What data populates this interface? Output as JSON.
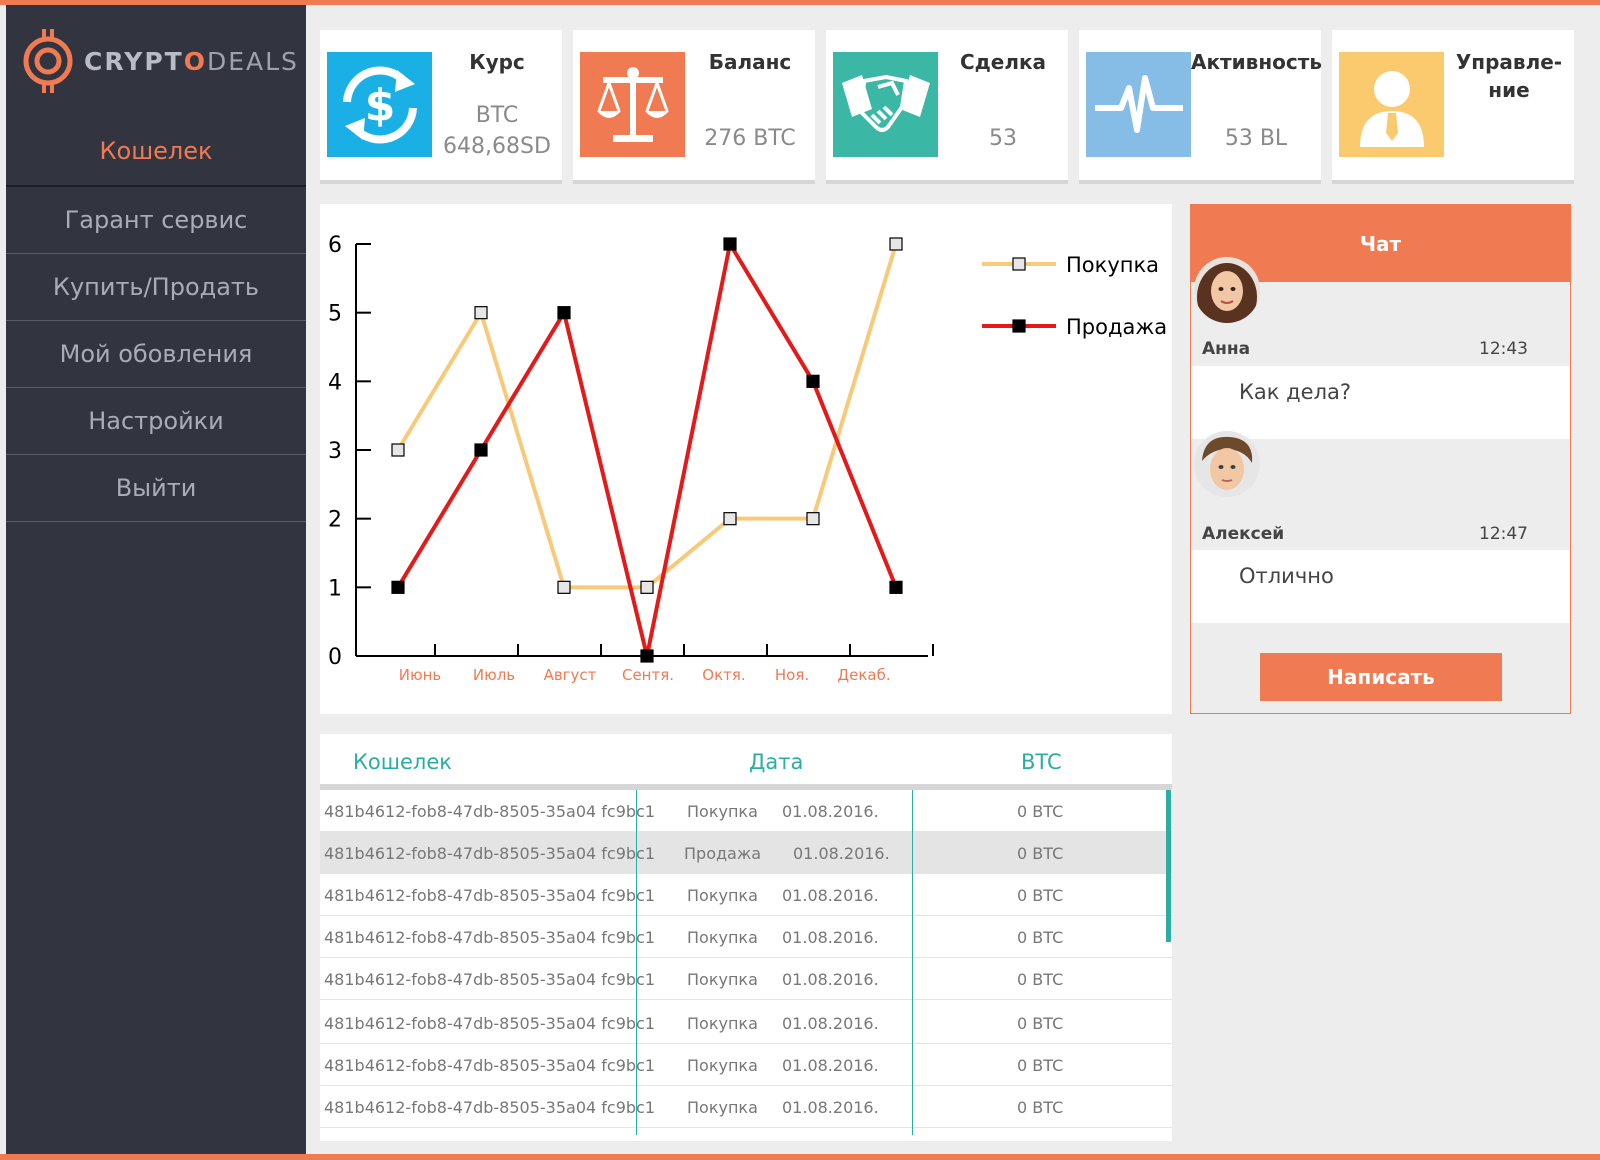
{
  "brand": {
    "crypto": "CRYPT",
    "o": "O",
    "deals": "DEALS"
  },
  "nav": {
    "items": [
      "Кошелек",
      "Гарант сервис",
      "Купить/Продать",
      "Мой обовления",
      "Настройки",
      "Выйти"
    ],
    "active": "Кошелек"
  },
  "cards": [
    {
      "title": "Курс",
      "line1": "BTC",
      "line2": "648,68SD",
      "icon": "dollar-exchange-icon",
      "color": "#1ab0e6"
    },
    {
      "title": "Баланс",
      "value": "276 BTC",
      "icon": "scales-icon",
      "color": "#f07a52"
    },
    {
      "title": "Сделка",
      "value": "53",
      "icon": "handshake-icon",
      "color": "#3bb7a6"
    },
    {
      "title": "Активность",
      "value": "53 BL",
      "icon": "pulse-icon",
      "color": "#86bde6"
    },
    {
      "title": "Управле-",
      "title2": "ние",
      "icon": "manager-icon",
      "color": "#fbc96e"
    }
  ],
  "chart_data": {
    "type": "line",
    "categories": [
      "Июнь",
      "Июль",
      "Август",
      "Сентя.",
      "Октя.",
      "Ноя.",
      "Декаб."
    ],
    "x": [
      0,
      1,
      2,
      3,
      4,
      5,
      6
    ],
    "series": [
      {
        "name": "Покупка",
        "color": "#f9c97a",
        "marker": "square-open",
        "values": [
          3,
          5,
          1,
          1,
          2,
          2,
          6
        ]
      },
      {
        "name": "Продажа",
        "color": "#e41a1a",
        "marker": "square-filled",
        "values": [
          1,
          3,
          5,
          0,
          6,
          4,
          1
        ]
      }
    ],
    "yticks": [
      0,
      1,
      2,
      3,
      4,
      5,
      6
    ],
    "ylim": [
      0,
      6
    ],
    "legend": "top-right",
    "grid": false
  },
  "chat": {
    "title": "Чат",
    "messages": [
      {
        "name": "Анна",
        "time": "12:43",
        "text": "Как дела?"
      },
      {
        "name": "Алексей",
        "time": "12:47",
        "text": "Отлично"
      }
    ],
    "button": "Написать"
  },
  "table": {
    "headers": [
      "Кошелек",
      "Дата",
      "BTC"
    ],
    "rows": [
      {
        "wallet": "481b4612-fob8-47db-8505-35a04 fc9bc1",
        "type": "Покупка",
        "date": "01.08.2016.",
        "btc": "0 BTC"
      },
      {
        "wallet": "481b4612-fob8-47db-8505-35a04 fc9bc1",
        "type": "Продажа",
        "date": "01.08.2016.",
        "btc": "0 BTC"
      },
      {
        "wallet": "481b4612-fob8-47db-8505-35a04 fc9bc1",
        "type": "Покупка",
        "date": "01.08.2016.",
        "btc": "0 BTC"
      },
      {
        "wallet": "481b4612-fob8-47db-8505-35a04 fc9bc1",
        "type": "Покупка",
        "date": "01.08.2016.",
        "btc": "0 BTC"
      },
      {
        "wallet": "481b4612-fob8-47db-8505-35a04 fc9bc1",
        "type": "Покупка",
        "date": "01.08.2016.",
        "btc": "0 BTC"
      },
      {
        "wallet": "481b4612-fob8-47db-8505-35a04 fc9bc1",
        "type": "Покупка",
        "date": "01.08.2016.",
        "btc": "0 BTC"
      },
      {
        "wallet": "481b4612-fob8-47db-8505-35a04 fc9bc1",
        "type": "Покупка",
        "date": "01.08.2016.",
        "btc": "0 BTC"
      },
      {
        "wallet": "481b4612-fob8-47db-8505-35a04 fc9bc1",
        "type": "Покупка",
        "date": "01.08.2016.",
        "btc": "0 BTC"
      }
    ]
  }
}
